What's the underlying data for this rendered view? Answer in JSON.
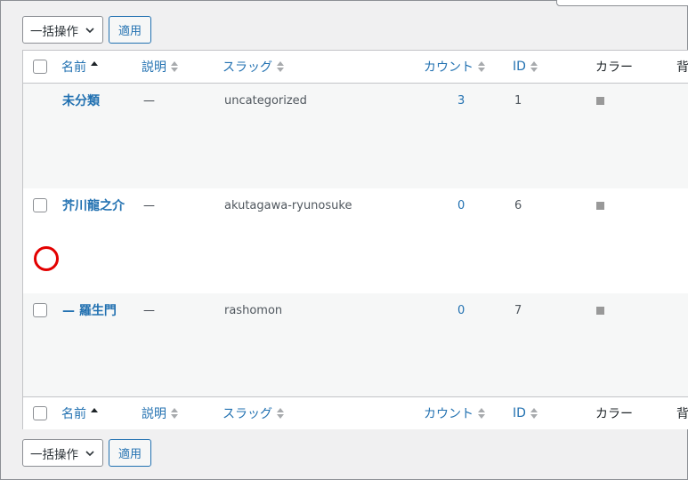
{
  "bulk_actions": {
    "label": "一括操作",
    "apply": "適用"
  },
  "columns": {
    "name": "名前",
    "description": "説明",
    "slug": "スラッグ",
    "count": "カウント",
    "id": "ID",
    "color": "カラー",
    "background": "背"
  },
  "rows": [
    {
      "name": "未分類",
      "description": "—",
      "slug": "uncategorized",
      "count": "3",
      "id": "1"
    },
    {
      "name": "芥川龍之介",
      "description": "—",
      "slug": "akutagawa-ryunosuke",
      "count": "0",
      "id": "6"
    },
    {
      "name": "— 羅生門",
      "description": "—",
      "slug": "rashomon",
      "count": "0",
      "id": "7"
    }
  ],
  "colors": {
    "swatch": "#999999",
    "link": "#2271b1",
    "annotation": "#e30000"
  }
}
